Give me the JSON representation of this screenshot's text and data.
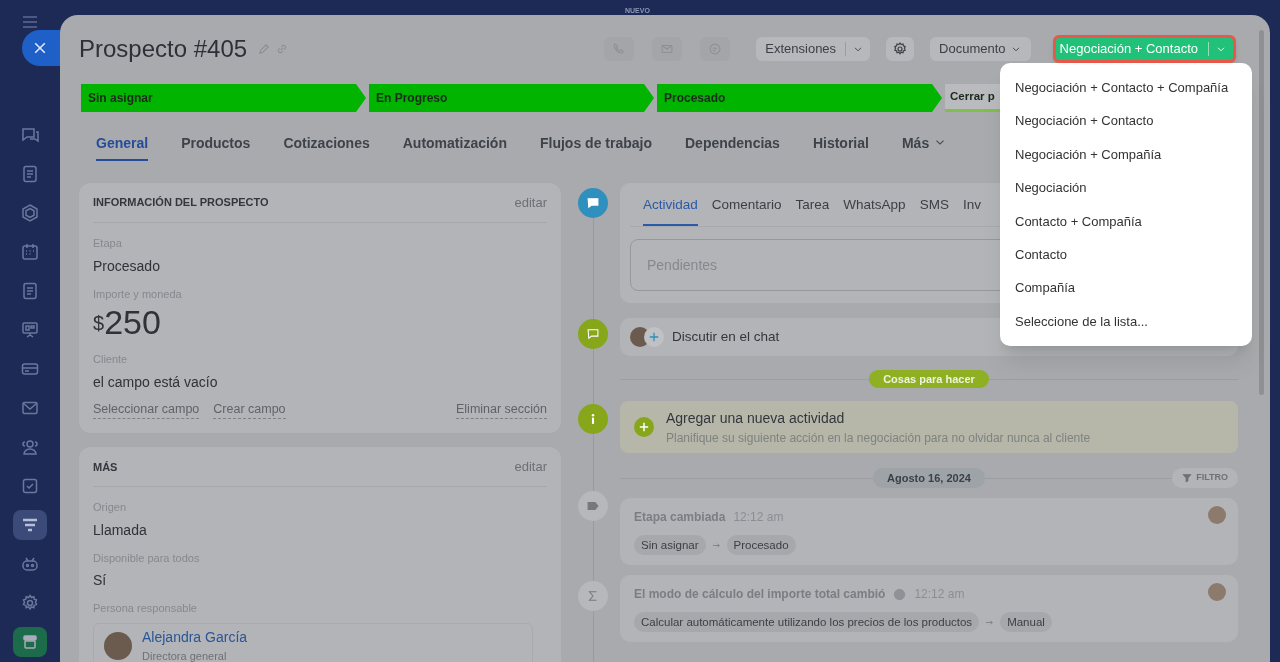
{
  "top_label": "NUEVO",
  "sidebar": {
    "items": [
      {
        "kind": "chat",
        "selected": false
      },
      {
        "kind": "document",
        "selected": false
      },
      {
        "kind": "hexagon",
        "selected": false
      },
      {
        "kind": "calendar",
        "selected": false
      },
      {
        "kind": "document",
        "selected": false
      },
      {
        "kind": "board",
        "selected": false
      },
      {
        "kind": "card",
        "selected": false
      },
      {
        "kind": "mail",
        "selected": false
      },
      {
        "kind": "users",
        "selected": false
      },
      {
        "kind": "task",
        "selected": false
      },
      {
        "kind": "funnel",
        "selected": true
      },
      {
        "kind": "robot",
        "selected": false
      },
      {
        "kind": "gear",
        "selected": false
      },
      {
        "kind": "app",
        "selected": false
      }
    ]
  },
  "header": {
    "title": "Prospecto #405",
    "extensions": "Extensiones",
    "document": "Documento",
    "convert_button": "Negociación + Contacto"
  },
  "stages": [
    {
      "label": "Sin asignar",
      "reached": true
    },
    {
      "label": "En Progreso",
      "reached": true
    },
    {
      "label": "Procesado",
      "reached": true
    },
    {
      "label": "Cerrar p",
      "reached": false
    }
  ],
  "tabs": [
    {
      "label": "General",
      "selected": true
    },
    {
      "label": "Productos",
      "selected": false
    },
    {
      "label": "Cotizaciones",
      "selected": false
    },
    {
      "label": "Automatización",
      "selected": false
    },
    {
      "label": "Flujos de trabajo",
      "selected": false
    },
    {
      "label": "Dependencias",
      "selected": false
    },
    {
      "label": "Historial",
      "selected": false
    },
    {
      "label": "Más",
      "selected": false,
      "caret": true
    }
  ],
  "dropdown": {
    "items": [
      "Negociación + Contacto + Compañía",
      "Negociación + Contacto",
      "Negociación + Compañía",
      "Negociación",
      "Contacto + Compañía",
      "Contacto",
      "Compañía",
      "Seleccione de la lista..."
    ]
  },
  "info_card": {
    "title": "INFORMACIÓN DEL PROSPECTO",
    "edit": "editar",
    "fields": [
      {
        "kind": "text",
        "label": "Etapa",
        "value": "Procesado"
      },
      {
        "kind": "money",
        "label": "Importe y moneda",
        "currency": "$",
        "value": "250"
      },
      {
        "kind": "text",
        "label": "Cliente",
        "value": "el campo está vacío"
      }
    ],
    "links": [
      "Seleccionar campo",
      "Crear campo"
    ],
    "remove_link": "Eliminar sección"
  },
  "more_card": {
    "title": "MÁS",
    "edit": "editar",
    "fields": [
      {
        "kind": "text",
        "label": "Origen",
        "value": "Llamada"
      },
      {
        "kind": "text",
        "label": "Disponible para todos",
        "value": "Sí"
      },
      {
        "kind": "person",
        "label": "Persona responsable",
        "name": "Alejandra García",
        "role": "Directora general"
      }
    ]
  },
  "activity": {
    "tabs": [
      {
        "label": "Actividad",
        "selected": true
      },
      {
        "label": "Comentario",
        "selected": false
      },
      {
        "label": "Tarea",
        "selected": false
      },
      {
        "label": "WhatsApp",
        "selected": false
      },
      {
        "label": "SMS",
        "selected": false
      },
      {
        "label": "Inv",
        "selected": false
      }
    ],
    "placeholder": "Pendientes"
  },
  "chat": {
    "label": "Discutir en el chat"
  },
  "todo_badge": "Cosas para hacer",
  "add_activity": {
    "title": "Agregar una nueva actividad",
    "subtitle": "Planifique su siguiente acción en la negociación para no olvidar nunca al cliente"
  },
  "date": "Agosto 16, 2024",
  "filter": "FILTRO",
  "events": [
    {
      "kind": "tag",
      "title": "Etapa cambiada",
      "help": false,
      "time": "12:12 am",
      "from": "Sin asignar",
      "to": "Procesado"
    },
    {
      "kind": "sum",
      "title": "El modo de cálculo del importe total cambió",
      "help": true,
      "time": "12:12 am",
      "from": "Calcular automáticamente utilizando los precios de los productos",
      "to": "Manual"
    }
  ]
}
